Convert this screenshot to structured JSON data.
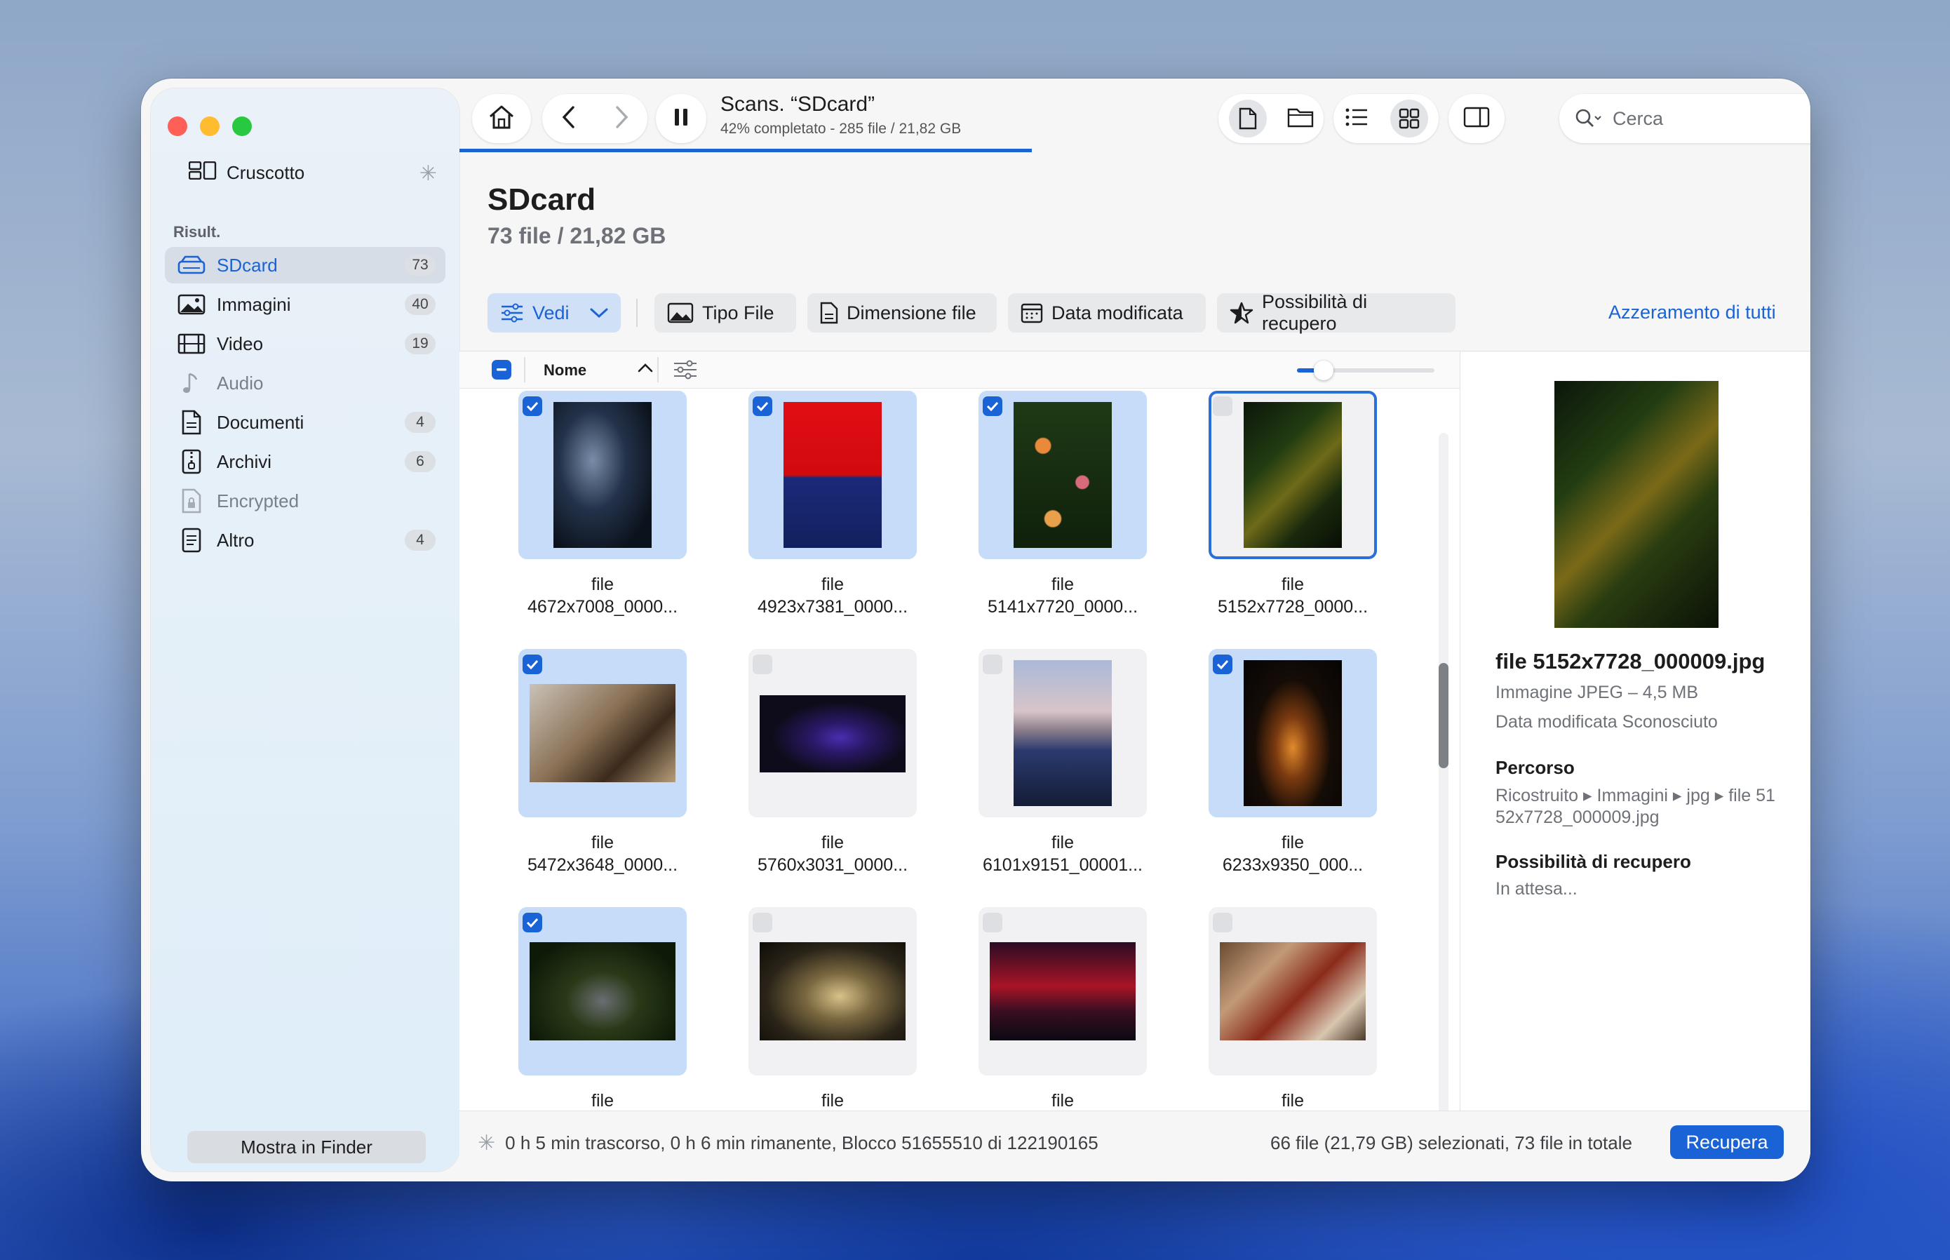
{
  "sidebar": {
    "dashboard_label": "Cruscotto",
    "section_label": "Risult.",
    "items": [
      {
        "label": "SDcard",
        "count": "73"
      },
      {
        "label": "Immagini",
        "count": "40"
      },
      {
        "label": "Video",
        "count": "19"
      },
      {
        "label": "Audio",
        "count": ""
      },
      {
        "label": "Documenti",
        "count": "4"
      },
      {
        "label": "Archivi",
        "count": "6"
      },
      {
        "label": "Encrypted",
        "count": ""
      },
      {
        "label": "Altro",
        "count": "4"
      }
    ],
    "finder_button": "Mostra in Finder"
  },
  "toolbar": {
    "scan_title": "Scans. “SDcard”",
    "scan_status": "42% completato - 285 file / 21,82 GB",
    "progress": 0.42,
    "search_placeholder": "Cerca"
  },
  "header": {
    "title": "SDcard",
    "subtitle": "73 file / 21,82 GB"
  },
  "filters": {
    "view": "Vedi",
    "file_type": "Tipo File",
    "file_size": "Dimensione file",
    "date_modified": "Data modificata",
    "recovery_chance": "Possibilità di recupero",
    "reset_all": "Azzeramento di tutti"
  },
  "list_header": {
    "name_column": "Nome"
  },
  "files": [
    {
      "line1": "file",
      "line2": "4672x7008_0000...",
      "checked": true
    },
    {
      "line1": "file",
      "line2": "4923x7381_0000...",
      "checked": true
    },
    {
      "line1": "file",
      "line2": "5141x7720_0000...",
      "checked": true
    },
    {
      "line1": "file",
      "line2": "5152x7728_0000...",
      "checked": false
    },
    {
      "line1": "file",
      "line2": "5472x3648_0000...",
      "checked": true
    },
    {
      "line1": "file",
      "line2": "5760x3031_0000...",
      "checked": false
    },
    {
      "line1": "file",
      "line2": "6101x9151_00001...",
      "checked": false
    },
    {
      "line1": "file",
      "line2": "6233x9350_000...",
      "checked": true
    },
    {
      "line1": "file",
      "line2": "",
      "checked": true
    },
    {
      "line1": "file",
      "line2": "",
      "checked": false
    },
    {
      "line1": "file",
      "line2": "",
      "checked": false
    },
    {
      "line1": "file",
      "line2": "",
      "checked": false
    }
  ],
  "detail": {
    "filename": "file 5152x7728_000009.jpg",
    "type": "Immagine JPEG – 4,5 MB",
    "date": "Data modificata  Sconosciuto",
    "path_heading": "Percorso",
    "path_line1": "Ricostruito ▸ Immagini ▸ jpg ▸ file 51",
    "path_line2": "52x7728_000009.jpg",
    "recovery_heading": "Possibilità di recupero",
    "recovery_value": "In attesa..."
  },
  "status": {
    "left": "0 h 5 min trascorso, 0 h 6 min rimanente, Blocco 51655510 di 122190165",
    "right": "66 file (21,79 GB) selezionati, 73 file in totale",
    "recover_button": "Recupera"
  },
  "colors": {
    "accent": "#1a63d6",
    "close": "#fe5f57",
    "minimize": "#febc2e",
    "zoom": "#28c840"
  }
}
